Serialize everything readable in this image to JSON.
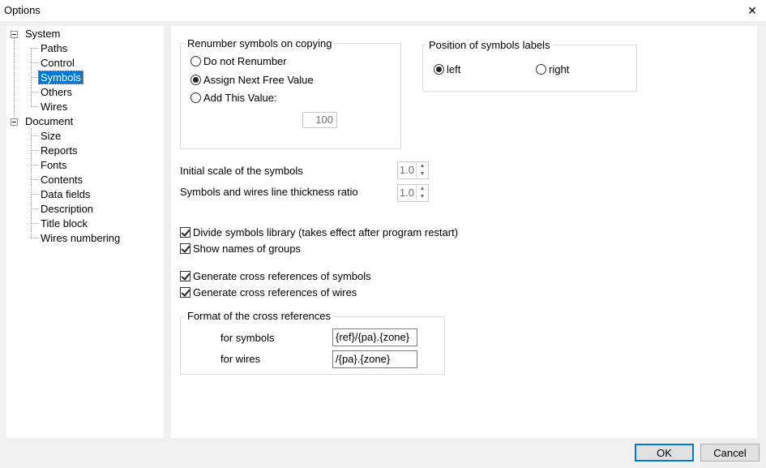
{
  "window": {
    "title": "Options",
    "close_glyph": "✕"
  },
  "tree": {
    "expander_glyph": "−",
    "system": {
      "label": "System",
      "children": [
        "Paths",
        "Control",
        "Symbols",
        "Others",
        "Wires"
      ]
    },
    "document": {
      "label": "Document",
      "children": [
        "Size",
        "Reports",
        "Fonts",
        "Contents",
        "Data fields",
        "Description",
        "Title block",
        "Wires numbering"
      ]
    },
    "selected": "Symbols"
  },
  "renumber": {
    "legend": "Renumber symbols on copying",
    "options": [
      "Do not Renumber",
      "Assign Next Free Value",
      "Add This Value:"
    ],
    "selected_index": 1,
    "add_value": "100"
  },
  "labels_position": {
    "legend": "Position of symbols labels",
    "options": [
      "left",
      "right"
    ],
    "selected_index": 0
  },
  "scale": {
    "initial_label": "Initial scale of the symbols",
    "initial_value": "1.0",
    "ratio_label": "Symbols and wires line thickness ratio",
    "ratio_value": "1.0",
    "up_glyph": "▲",
    "down_glyph": "▼"
  },
  "checks": {
    "divide_library": {
      "label": "Divide symbols library (takes effect after program restart)",
      "checked": true
    },
    "show_group_names": {
      "label": "Show names of groups",
      "checked": true
    },
    "xref_symbols": {
      "label": "Generate cross references of symbols",
      "checked": true
    },
    "xref_wires": {
      "label": "Generate cross references of wires",
      "checked": true
    }
  },
  "xref_format": {
    "legend": "Format of the cross references",
    "symbols_label": "for symbols",
    "symbols_value": "{ref}/{pa}.{zone}",
    "wires_label": "for wires",
    "wires_value": "/{pa}.{zone}"
  },
  "buttons": {
    "ok": "OK",
    "cancel": "Cancel"
  },
  "colors": {
    "selection": "#0078d7",
    "default_button_border": "#0078d7"
  }
}
